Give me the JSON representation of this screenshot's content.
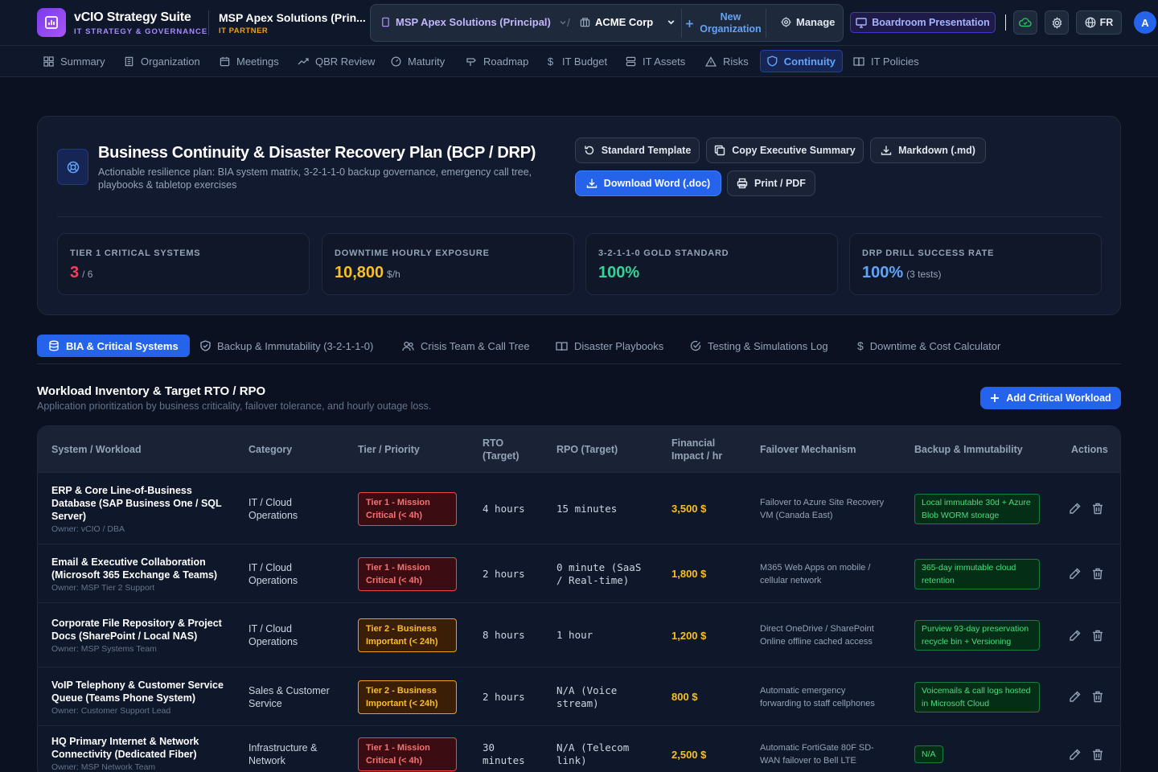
{
  "app": {
    "name": "vCIO Strategy Suite",
    "tagline": "IT STRATEGY & GOVERNANCE",
    "client_name": "MSP Apex Solutions (Prin...",
    "client_role": "IT PARTNER"
  },
  "org_switcher": {
    "principal": "MSP Apex Solutions (Principal)",
    "separator": "/",
    "current_org": "ACME Corp",
    "new_org_label": "New Organization",
    "manage_label": "Manage"
  },
  "header_actions": {
    "boardroom_label": "Boardroom Presentation",
    "language": "FR",
    "avatar_initial": "A"
  },
  "nav": [
    {
      "label": "Summary",
      "icon": "grid-icon"
    },
    {
      "label": "Organization",
      "icon": "building-icon"
    },
    {
      "label": "Meetings",
      "icon": "calendar-icon"
    },
    {
      "label": "QBR Review",
      "icon": "trend-icon"
    },
    {
      "label": "Maturity",
      "icon": "gauge-icon"
    },
    {
      "label": "Roadmap",
      "icon": "signpost-icon"
    },
    {
      "label": "IT Budget",
      "icon": "dollar-icon"
    },
    {
      "label": "IT Assets",
      "icon": "server-icon"
    },
    {
      "label": "Risks",
      "icon": "warning-icon"
    },
    {
      "label": "Continuity",
      "icon": "shield-icon",
      "active": true
    },
    {
      "label": "IT Policies",
      "icon": "book-icon"
    }
  ],
  "hero": {
    "title": "Business Continuity & Disaster Recovery Plan (BCP / DRP)",
    "subtitle": "Actionable resilience plan: BIA system matrix, 3-2-1-1-0 backup governance, emergency call tree, playbooks & tabletop exercises",
    "buttons": {
      "standard_template": "Standard Template",
      "copy_exec_summary": "Copy Executive Summary",
      "markdown": "Markdown (.md)",
      "download_word": "Download Word (.doc)",
      "print_pdf": "Print / PDF"
    }
  },
  "kpis": [
    {
      "label": "TIER 1 CRITICAL SYSTEMS",
      "value": "3",
      "unit": "/ 6",
      "color": "#f43f5e"
    },
    {
      "label": "DOWNTIME HOURLY EXPOSURE",
      "value": "10,800",
      "unit": "$/h",
      "color": "#fbbf24"
    },
    {
      "label": "3-2-1-1-0 GOLD STANDARD",
      "value": "100%",
      "unit": "",
      "color": "#34d399"
    },
    {
      "label": "DRP DRILL SUCCESS RATE",
      "value": "100%",
      "unit": "(3 tests)",
      "color": "#60a5fa"
    }
  ],
  "tabs": [
    {
      "label": "BIA & Critical Systems",
      "icon": "database-icon",
      "active": true
    },
    {
      "label": "Backup & Immutability (3-2-1-1-0)",
      "icon": "shield-check-icon"
    },
    {
      "label": "Crisis Team & Call Tree",
      "icon": "users-icon"
    },
    {
      "label": "Disaster Playbooks",
      "icon": "book-open-icon"
    },
    {
      "label": "Testing & Simulations Log",
      "icon": "check-circle-icon"
    },
    {
      "label": "Downtime & Cost Calculator",
      "icon": "dollar-icon"
    }
  ],
  "section": {
    "title": "Workload Inventory & Target RTO / RPO",
    "subtitle": "Application prioritization by business criticality, failover tolerance, and hourly outage loss.",
    "add_button": "Add Critical Workload"
  },
  "table": {
    "headers": {
      "system": "System / Workload",
      "category": "Category",
      "tier": "Tier / Priority",
      "rto": "RTO (Target)",
      "rpo": "RPO (Target)",
      "financial": "Financial Impact / hr",
      "failover": "Failover Mechanism",
      "backup": "Backup & Immutability",
      "actions": "Actions"
    },
    "rows": [
      {
        "name": "ERP & Core Line-of-Business Database (SAP Business One / SQL Server)",
        "owner": "Owner: vCIO / DBA",
        "category": "IT / Cloud Operations",
        "tier": "Tier 1 - Mission Critical (< 4h)",
        "tier_level": 1,
        "rto": "4 hours",
        "rpo": "15 minutes",
        "financial": "3,500 $",
        "failover": "Failover to Azure Site Recovery VM (Canada East)",
        "backup": "Local immutable 30d + Azure Blob WORM storage"
      },
      {
        "name": "Email & Executive Collaboration (Microsoft 365 Exchange & Teams)",
        "owner": "Owner: MSP Tier 2 Support",
        "category": "IT / Cloud Operations",
        "tier": "Tier 1 - Mission Critical (< 4h)",
        "tier_level": 1,
        "rto": "2 hours",
        "rpo": "0 minute (SaaS / Real-time)",
        "financial": "1,800 $",
        "failover": "M365 Web Apps on mobile / cellular network",
        "backup": "365-day immutable cloud retention"
      },
      {
        "name": "Corporate File Repository & Project Docs (SharePoint / Local NAS)",
        "owner": "Owner: MSP Systems Team",
        "category": "IT / Cloud Operations",
        "tier": "Tier 2 - Business Important (< 24h)",
        "tier_level": 2,
        "rto": "8 hours",
        "rpo": "1 hour",
        "financial": "1,200 $",
        "failover": "Direct OneDrive / SharePoint Online offline cached access",
        "backup": "Purview 93-day preservation recycle bin + Versioning"
      },
      {
        "name": "VoIP Telephony & Customer Service Queue (Teams Phone System)",
        "owner": "Owner: Customer Support Lead",
        "category": "Sales & Customer Service",
        "tier": "Tier 2 - Business Important (< 24h)",
        "tier_level": 2,
        "rto": "2 hours",
        "rpo": "N/A (Voice stream)",
        "financial": "800 $",
        "failover": "Automatic emergency forwarding to staff cellphones",
        "backup": "Voicemails & call logs hosted in Microsoft Cloud"
      },
      {
        "name": "HQ Primary Internet & Network Connectivity (Dedicated Fiber)",
        "owner": "Owner: MSP Network Team",
        "category": "Infrastructure & Network",
        "tier": "Tier 1 - Mission Critical (< 4h)",
        "tier_level": 1,
        "rto": "30 minutes",
        "rpo": "N/A (Telecom link)",
        "financial": "2,500 $",
        "failover": "Automatic FortiGate 80F SD-WAN failover to Bell LTE",
        "backup": "N/A"
      }
    ]
  }
}
